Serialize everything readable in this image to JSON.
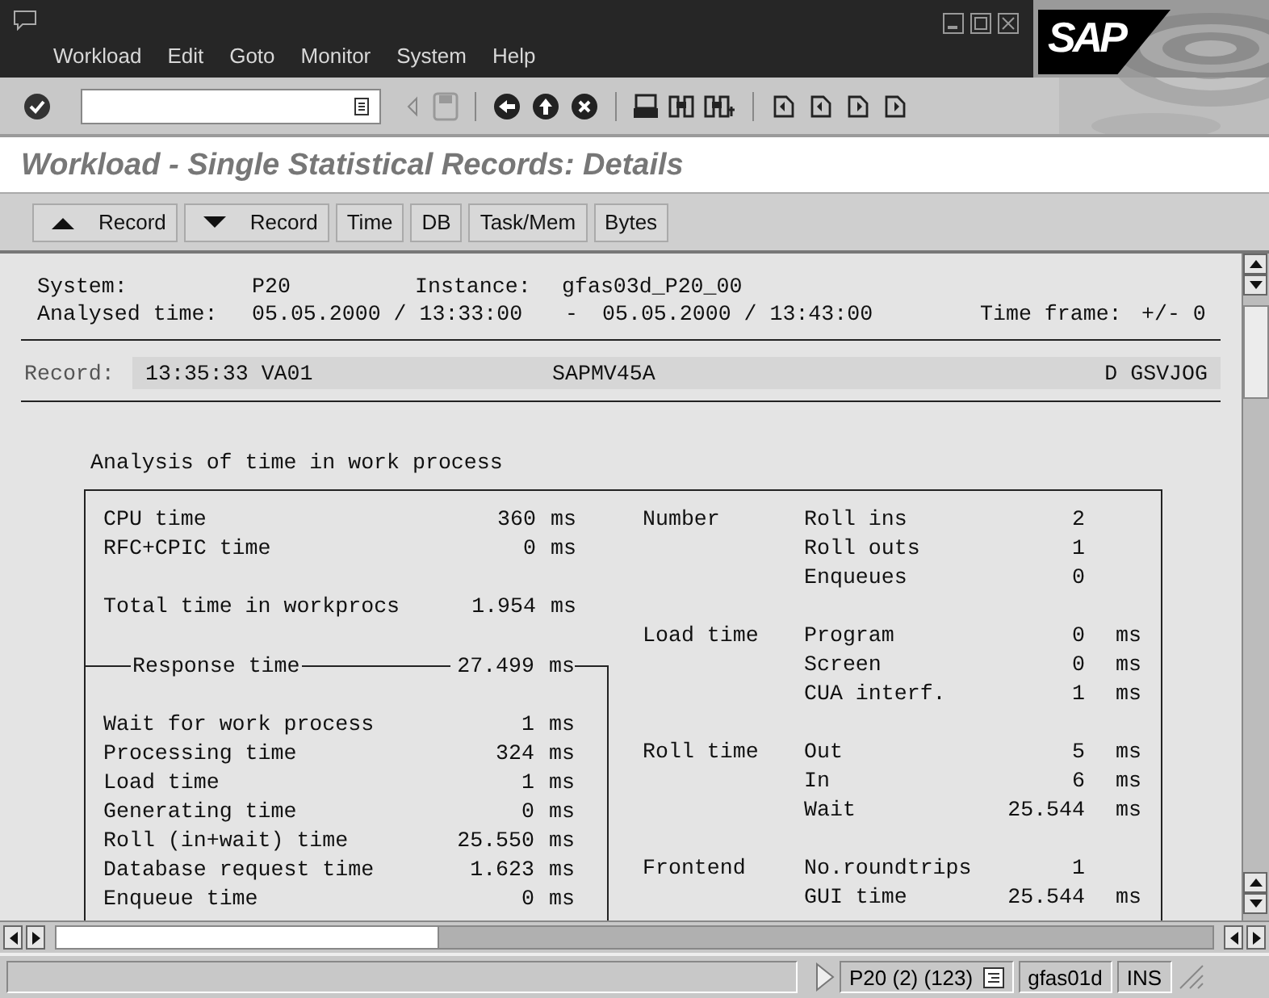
{
  "menu": [
    "Workload",
    "Edit",
    "Goto",
    "Monitor",
    "System",
    "Help"
  ],
  "logo": "SAP",
  "title": "Workload - Single Statistical Records: Details",
  "app_buttons": [
    {
      "label": "Record",
      "kind": "up"
    },
    {
      "label": "Record",
      "kind": "down"
    },
    {
      "label": "Time",
      "kind": "plain"
    },
    {
      "label": "DB",
      "kind": "plain"
    },
    {
      "label": "Task/Mem",
      "kind": "plain"
    },
    {
      "label": "Bytes",
      "kind": "plain"
    }
  ],
  "header": {
    "system_label": "System:",
    "system": "P20",
    "instance_label": "Instance:",
    "instance": "gfas03d_P20_00",
    "analysed_label": "Analysed time:",
    "from": "05.05.2000 / 13:33:00",
    "dash": "-",
    "to": "05.05.2000 / 13:43:00",
    "timeframe_label": "Time frame:",
    "timeframe": "+/- 0"
  },
  "record": {
    "label": "Record:",
    "time_tcode": "13:35:33 VA01",
    "program": "SAPMV45A",
    "user": "D GSVJOG"
  },
  "analysis": {
    "title": "Analysis of time in work process",
    "left_blocks": [
      {
        "rows": [
          {
            "label": "CPU time",
            "value": "360",
            "unit": "ms"
          },
          {
            "label": "RFC+CPIC time",
            "value": "0",
            "unit": "ms"
          }
        ]
      },
      {
        "rows": [
          {
            "label": "Total time in workprocs",
            "value": "1.954",
            "unit": "ms"
          }
        ]
      }
    ],
    "response": {
      "label": "Response time",
      "value": "27.499",
      "unit": "ms",
      "rows": [
        {
          "label": "Wait for work process",
          "value": "1",
          "unit": "ms"
        },
        {
          "label": "Processing time",
          "value": "324",
          "unit": "ms"
        },
        {
          "label": "Load time",
          "value": "1",
          "unit": "ms"
        },
        {
          "label": "Generating time",
          "value": "0",
          "unit": "ms"
        },
        {
          "label": "Roll (in+wait) time",
          "value": "25.550",
          "unit": "ms"
        },
        {
          "label": "Database request time",
          "value": "1.623",
          "unit": "ms"
        },
        {
          "label": "Enqueue time",
          "value": "0",
          "unit": "ms"
        }
      ]
    },
    "right_groups": [
      {
        "label": "Number",
        "rows": [
          {
            "label": "Roll ins",
            "value": "2"
          },
          {
            "label": "Roll outs",
            "value": "1"
          },
          {
            "label": "Enqueues",
            "value": "0"
          }
        ]
      },
      {
        "label": "Load time",
        "rows": [
          {
            "label": "Program",
            "value": "0",
            "unit": "ms"
          },
          {
            "label": "Screen",
            "value": "0",
            "unit": "ms"
          },
          {
            "label": "CUA interf.",
            "value": "1",
            "unit": "ms"
          }
        ]
      },
      {
        "label": "Roll time",
        "rows": [
          {
            "label": "Out",
            "value": "5",
            "unit": "ms"
          },
          {
            "label": "In",
            "value": "6",
            "unit": "ms"
          },
          {
            "label": "Wait",
            "value": "25.544",
            "unit": "ms"
          }
        ]
      },
      {
        "label": "Frontend",
        "rows": [
          {
            "label": "No.roundtrips",
            "value": "1"
          },
          {
            "label": "GUI time",
            "value": "25.544",
            "unit": "ms"
          }
        ]
      }
    ]
  },
  "status": {
    "segments": [
      "P20 (2) (123)",
      "gfas01d",
      "INS"
    ]
  }
}
